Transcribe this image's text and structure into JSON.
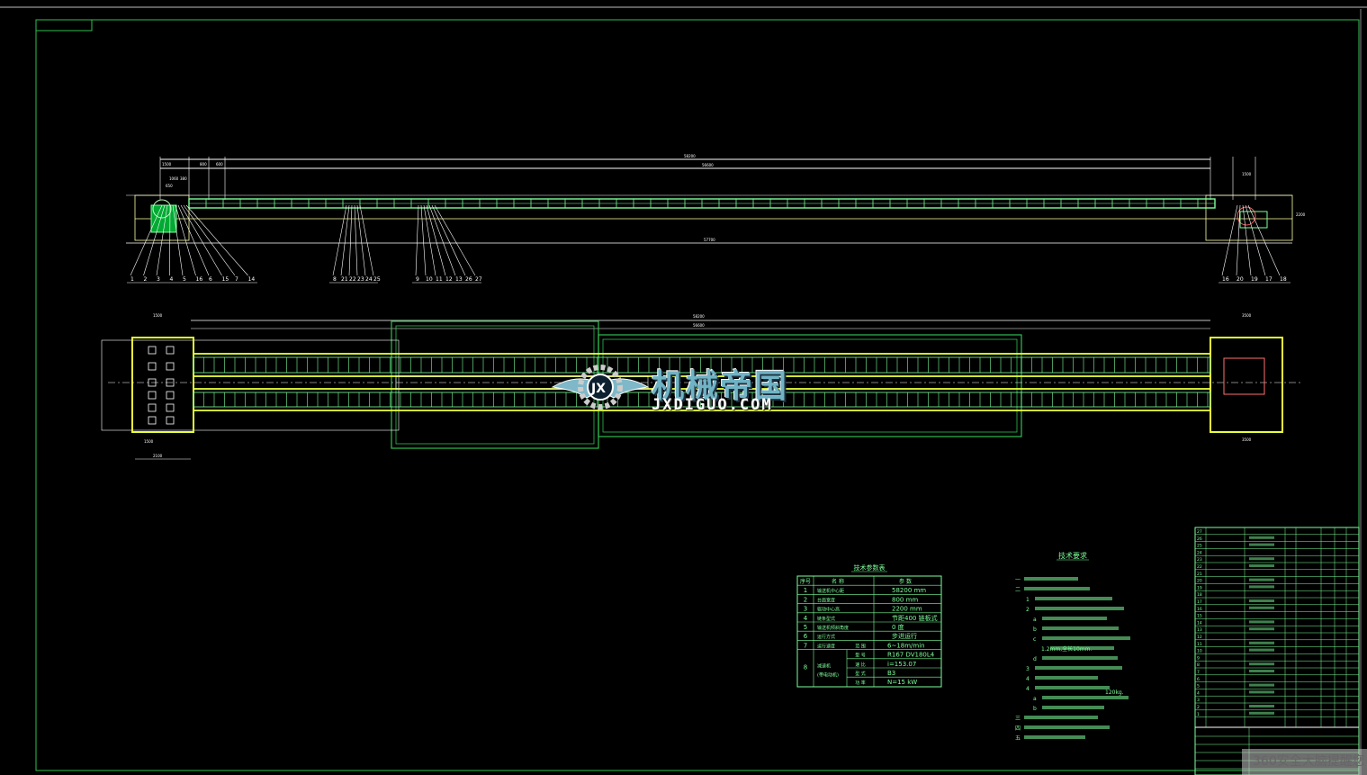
{
  "colors": {
    "background": "#000000",
    "frame": "#2fbf4f",
    "belt": "#7dff9a",
    "rail": "#e8ff3a",
    "dim": "#ffffff"
  },
  "elevation": {
    "dims_top": [
      "58200",
      "1500",
      "800",
      "600",
      "56600",
      "1060",
      "380",
      "650",
      "1500",
      "2200"
    ],
    "dim_bottom": "57700",
    "part_labels_left": [
      "1",
      "2",
      "3",
      "4",
      "5",
      "16",
      "6",
      "15",
      "7",
      "14"
    ],
    "part_labels_mid1": [
      "8",
      "21",
      "22",
      "23",
      "24",
      "25"
    ],
    "part_labels_mid2": [
      "9",
      "10",
      "11",
      "12",
      "13",
      "26",
      "27"
    ],
    "part_labels_right": [
      "16",
      "20",
      "19",
      "17",
      "18"
    ]
  },
  "plan": {
    "dims": [
      "58200",
      "56600",
      "1500",
      "3500",
      "2100",
      "1500"
    ]
  },
  "logo": {
    "cn": "机械帝国",
    "en": "JXDIGUO.COM",
    "badge": "JX"
  },
  "params": {
    "title": "技术参数表",
    "headers": [
      "序号",
      "名 称",
      "参 数"
    ],
    "rows": [
      {
        "no": "1",
        "name": "输送机中心距",
        "value": "58200 mm"
      },
      {
        "no": "2",
        "name": "台面宽度",
        "value": "800 mm"
      },
      {
        "no": "3",
        "name": "驱动中心高",
        "value": "2200 mm"
      },
      {
        "no": "4",
        "name": "链条型式",
        "value": "节距400 链板式"
      },
      {
        "no": "5",
        "name": "输送机倾斜角度",
        "value": "0 度"
      },
      {
        "no": "6",
        "name": "运行方式",
        "value": "步进运行"
      },
      {
        "no": "7",
        "name": "运行速度",
        "sub": "范 围",
        "value": "6~18m/min"
      }
    ],
    "reducer": {
      "no": "8",
      "name": "减速机",
      "name2": "(带电动机)",
      "subs": [
        {
          "k": "型 号",
          "v": "R167 DV180L4"
        },
        {
          "k": "速 比",
          "v": "i=153.07"
        },
        {
          "k": "型 式",
          "v": "B3"
        },
        {
          "k": "功 率",
          "v": "N=15 kW"
        }
      ]
    }
  },
  "tech": {
    "title": "技术要求",
    "lines": [
      "一",
      "二",
      "1",
      "2",
      "a",
      "b",
      "c",
      "1.2mm,全长10mm.",
      "d",
      "3",
      "4",
      "4",
      "a",
      "b",
      "三",
      "四",
      "五"
    ],
    "fragment": "120kg."
  },
  "bom": {
    "row_numbers": [
      "27",
      "26",
      "25",
      "24",
      "23",
      "22",
      "21",
      "20",
      "19",
      "18",
      "17",
      "16",
      "15",
      "14",
      "13",
      "12",
      "11",
      "10",
      "9",
      "8",
      "7",
      "6",
      "5",
      "4",
      "3",
      "2",
      "1"
    ]
  },
  "watermark": "360安全大脑提醒您"
}
